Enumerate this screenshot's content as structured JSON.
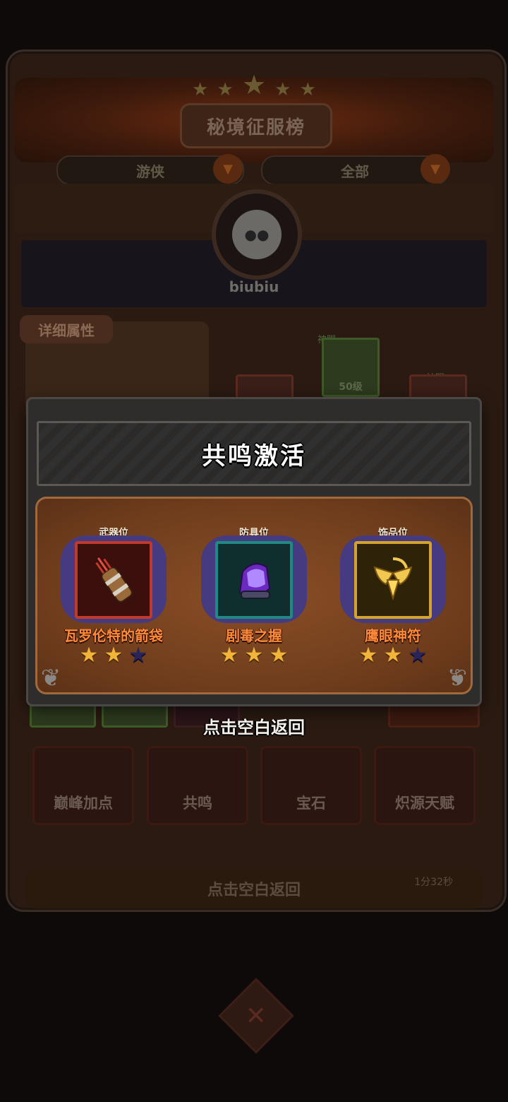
{
  "background": {
    "title": "秘境征服榜",
    "dropdowns": [
      "游侠",
      "全部"
    ],
    "player_name": "biubiu",
    "detail_tag": "详细属性",
    "slot_level": "50级",
    "slot_labels": [
      "神赐",
      "神赐"
    ],
    "tabs": [
      "巅峰加点",
      "共鸣",
      "宝石",
      "炽源天赋"
    ],
    "bottom_hint": "点击空白返回",
    "timer": "1分32秒"
  },
  "modal": {
    "title": "共鸣激活",
    "items": [
      {
        "slot": "武器位",
        "name": "瓦罗伦特的箭袋",
        "icon": "quiver-icon",
        "frame_color": "#c0392b",
        "stars_filled": 2,
        "stars_total": 3
      },
      {
        "slot": "防具位",
        "name": "剧毒之握",
        "icon": "gauntlet-icon",
        "frame_color": "#1f8a84",
        "stars_filled": 3,
        "stars_total": 3
      },
      {
        "slot": "饰品位",
        "name": "鹰眼神符",
        "icon": "winged-amulet-icon",
        "frame_color": "#d4a42a",
        "stars_filled": 2,
        "stars_total": 3
      }
    ]
  },
  "tap_hint": "点击空白返回"
}
